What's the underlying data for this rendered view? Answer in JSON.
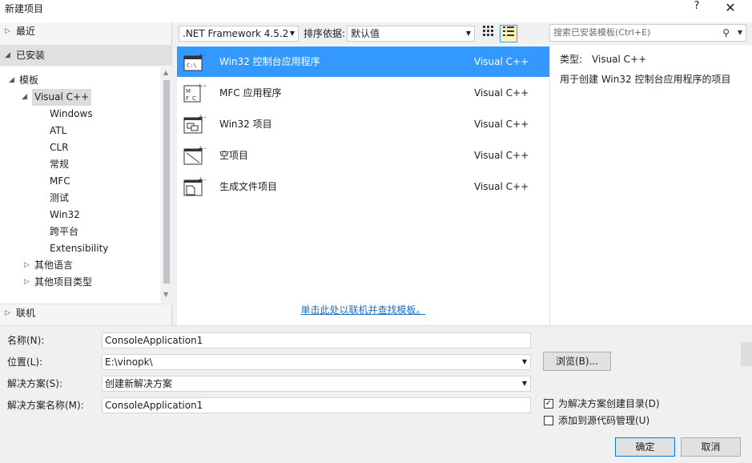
{
  "window": {
    "title": "新建项目",
    "help": "?",
    "close": "✕"
  },
  "tree": {
    "recent": "最近",
    "installed": "已安装",
    "items": [
      {
        "label": "模板"
      },
      {
        "label": "Visual C++"
      },
      {
        "label": "Windows"
      },
      {
        "label": "ATL"
      },
      {
        "label": "CLR"
      },
      {
        "label": "常规"
      },
      {
        "label": "MFC"
      },
      {
        "label": "测试"
      },
      {
        "label": "Win32"
      },
      {
        "label": "跨平台"
      },
      {
        "label": "Extensibility"
      },
      {
        "label": "其他语言"
      },
      {
        "label": "其他项目类型"
      }
    ],
    "online": "联机"
  },
  "toolbar": {
    "framework": ".NET Framework 4.5.2",
    "sort_label": "排序依据:",
    "sort_value": "默认值"
  },
  "search": {
    "placeholder": "搜索已安装模板(Ctrl+E)"
  },
  "templates": [
    {
      "name": "Win32 控制台应用程序",
      "lang": "Visual C++",
      "icon": "console-app-icon"
    },
    {
      "name": "MFC 应用程序",
      "lang": "Visual C++",
      "icon": "mfc-app-icon"
    },
    {
      "name": "Win32 项目",
      "lang": "Visual C++",
      "icon": "win32-project-icon"
    },
    {
      "name": "空项目",
      "lang": "Visual C++",
      "icon": "empty-project-icon"
    },
    {
      "name": "生成文件项目",
      "lang": "Visual C++",
      "icon": "makefile-project-icon"
    }
  ],
  "online_link": "单击此处以联机并查找模板。",
  "details": {
    "type_label": "类型:",
    "type_value": "Visual C++",
    "description": "用于创建 Win32 控制台应用程序的项目"
  },
  "form": {
    "name_label": "名称(N):",
    "name_value": "ConsoleApplication1",
    "location_label": "位置(L):",
    "location_value": "E:\\vinopk\\",
    "browse": "浏览(B)...",
    "solution_label": "解决方案(S):",
    "solution_value": "创建新解决方案",
    "solution_name_label": "解决方案名称(M):",
    "solution_name_value": "ConsoleApplication1",
    "create_dir": "为解决方案创建目录(D)",
    "add_source_control": "添加到源代码管理(U)",
    "ok": "确定",
    "cancel": "取消"
  },
  "colors": {
    "selection": "#3399ff",
    "link": "#1a6ec7"
  }
}
